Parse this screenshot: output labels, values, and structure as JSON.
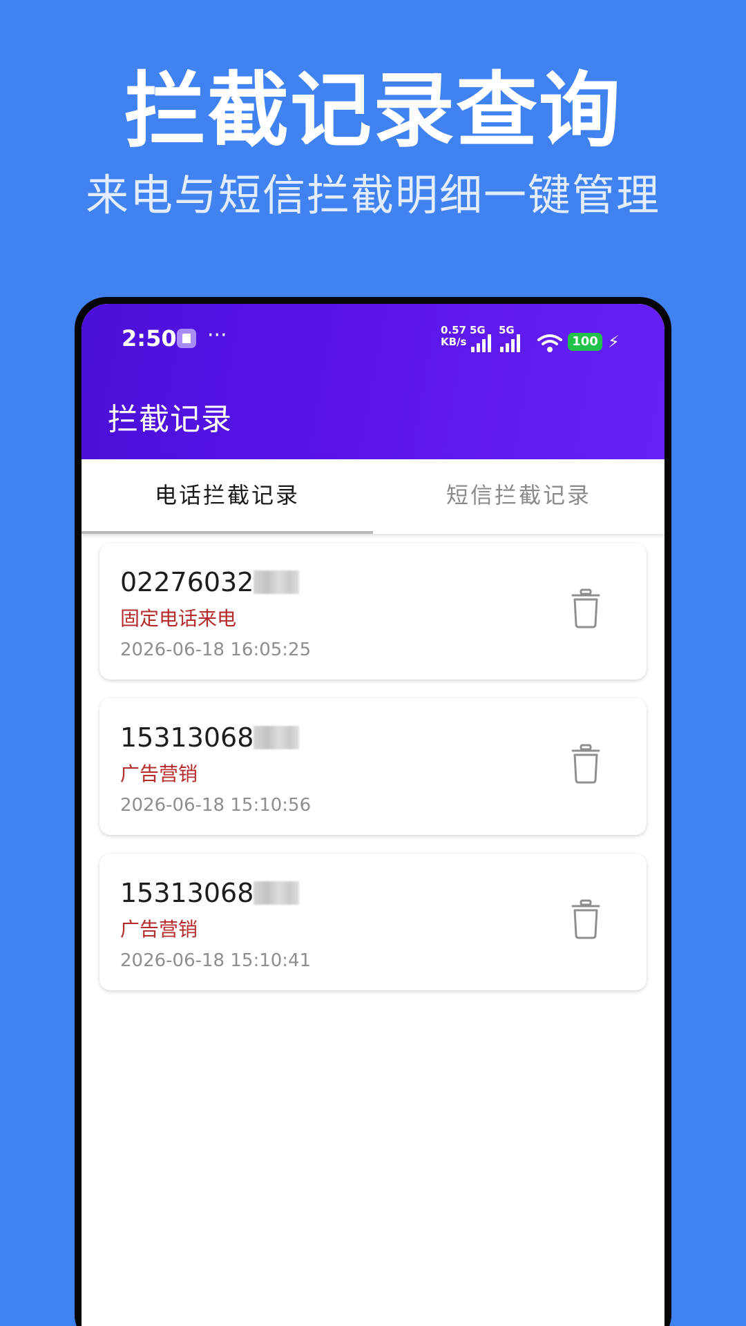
{
  "promo": {
    "headline": "拦截记录查询",
    "subhead": "来电与短信拦截明细一键管理"
  },
  "status_bar": {
    "time": "2:50",
    "dots": "···",
    "speed_value": "0.57",
    "speed_unit": "KB/s",
    "net1": "5G",
    "net2": "5G",
    "battery": "100",
    "charging_icon": "bolt-icon"
  },
  "app": {
    "title": "拦截记录"
  },
  "tabs": [
    {
      "label": "电话拦截记录",
      "active": true
    },
    {
      "label": "短信拦截记录",
      "active": false
    }
  ],
  "records": [
    {
      "number": "02276032",
      "tag": "固定电话来电",
      "time": "2026-06-18 16:05:25"
    },
    {
      "number": "15313068",
      "tag": "广告营销",
      "time": "2026-06-18 15:10:56"
    },
    {
      "number": "15313068",
      "tag": "广告营销",
      "time": "2026-06-18 15:10:41"
    }
  ],
  "colors": {
    "page_bg": "#3f82f0",
    "appbar_start": "#4a10d8",
    "appbar_end": "#6622f6",
    "tag_red": "#b52a2a",
    "battery_green": "#22c14a"
  }
}
